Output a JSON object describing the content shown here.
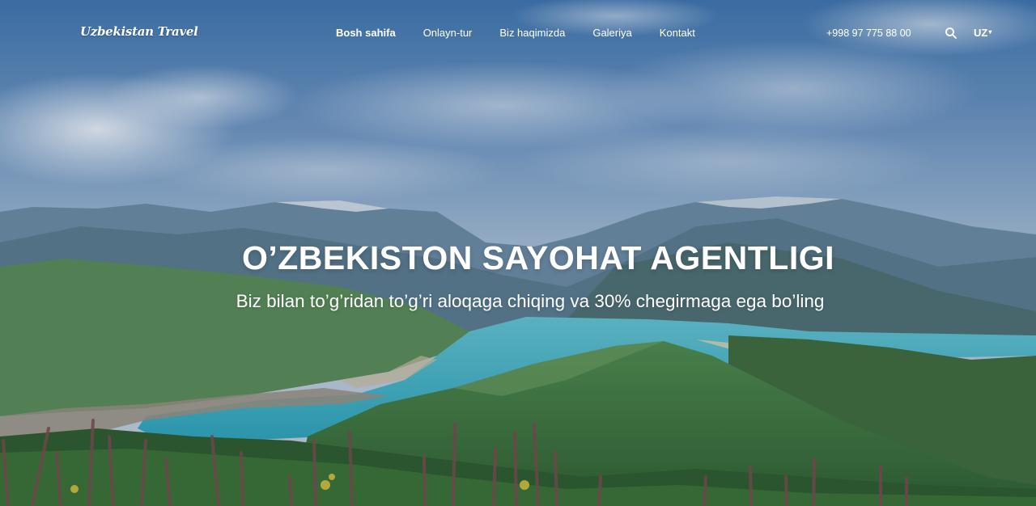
{
  "brand": {
    "logo_text": "Uzbekistan Travel"
  },
  "nav": {
    "items": [
      {
        "label": "Bosh sahifa",
        "active": true
      },
      {
        "label": "Onlayn-tur",
        "active": false
      },
      {
        "label": "Biz haqimizda",
        "active": false
      },
      {
        "label": "Galeriya",
        "active": false
      },
      {
        "label": "Kontakt",
        "active": false
      }
    ],
    "phone": "+998 97 775 88 00",
    "search_icon": "search-icon",
    "language": "UZ",
    "language_caret": "▾"
  },
  "hero": {
    "title": "O’ZBEKISTON SAYOHAT AGENTLIGI",
    "subtitle": "Biz bilan to’g’ridan to’g’ri aloqaga chiqing va 30% chegirmaga ega bo’ling"
  },
  "colors": {
    "sky_top": "#3f74ad",
    "sky_mid": "#8eabc8",
    "lake": "#3fb2c4",
    "mountain": "#5f8197",
    "hill_green": "#3f7a3c"
  }
}
